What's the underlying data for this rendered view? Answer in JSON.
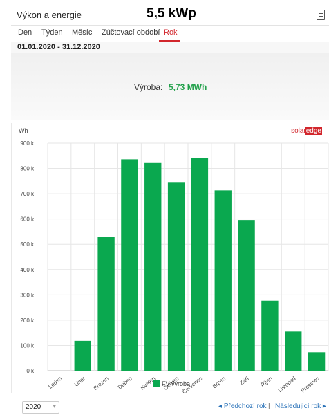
{
  "header": {
    "title": "Výkon a energie",
    "badge": "5,5 kWp",
    "export_icon": "pdf-icon"
  },
  "tabs": [
    {
      "label": "Den",
      "active": false
    },
    {
      "label": "Týden",
      "active": false
    },
    {
      "label": "Měsíc",
      "active": false
    },
    {
      "label": "Zúčtovací období",
      "active": false
    },
    {
      "label": "Rok",
      "active": true
    }
  ],
  "date_range": "01.01.2020 - 31.12.2020",
  "summary": {
    "label": "Výroba:",
    "value": "5,73 MWh"
  },
  "chart": {
    "brand_solar": "solar",
    "brand_edge": "edge"
  },
  "chart_data": {
    "type": "bar",
    "ylabel": "Wh",
    "ylim": [
      0,
      900000
    ],
    "yticks": [
      0,
      100000,
      200000,
      300000,
      400000,
      500000,
      600000,
      700000,
      800000,
      900000
    ],
    "ytick_labels": [
      "0 k",
      "100 k",
      "200 k",
      "300 k",
      "400 k",
      "500 k",
      "600 k",
      "700 k",
      "800 k",
      "900 k"
    ],
    "categories": [
      "Leden",
      "Únor",
      "Březen",
      "Duben",
      "Květen",
      "Červen",
      "Červenec",
      "Srpen",
      "Září",
      "Říjen",
      "Listopad",
      "Prosinec"
    ],
    "series": [
      {
        "name": "FV výroba",
        "color": "#0aa84f",
        "values": [
          0,
          118000,
          530000,
          836000,
          824000,
          746000,
          840000,
          713000,
          596000,
          277000,
          155000,
          73000
        ]
      }
    ],
    "grid": true,
    "legend": "bottom"
  },
  "footer": {
    "year": "2020",
    "prev": "Předchozí rok",
    "next": "Následující rok",
    "separator": "|"
  }
}
